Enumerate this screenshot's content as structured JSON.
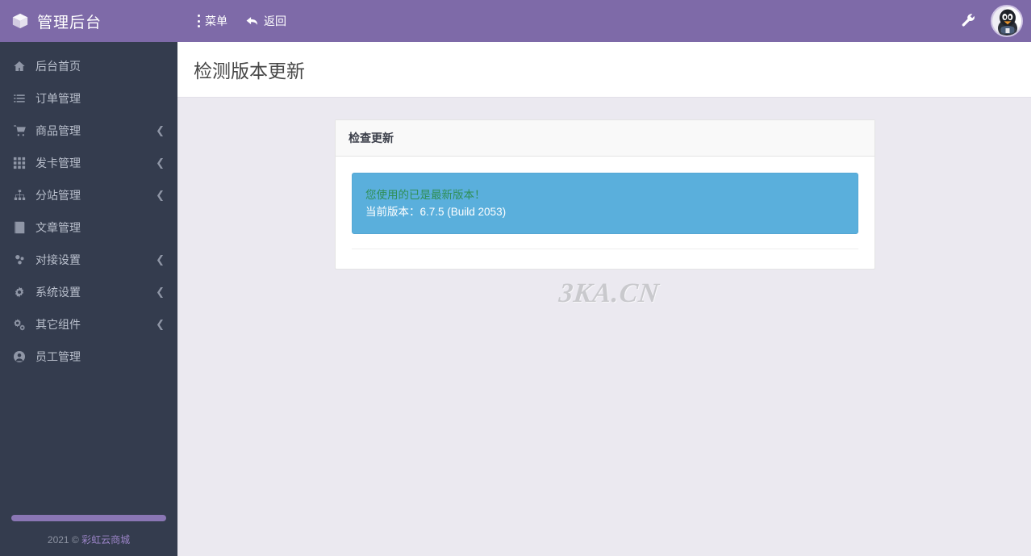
{
  "header": {
    "brand_title": "管理后台",
    "brand_icon": "cube-icon",
    "nav": [
      {
        "label": "菜单",
        "icon": "vertical-dots-icon"
      },
      {
        "label": "返回",
        "icon": "back-arrow-icon"
      }
    ],
    "tools_icon": "wrench-icon",
    "avatar_icon": "qq-penguin-avatar",
    "bar_color": "#7e6aa8"
  },
  "sidebar": {
    "background_color": "#343c4e",
    "items": [
      {
        "label": "后台首页",
        "icon": "home-icon",
        "has_submenu": false
      },
      {
        "label": "订单管理",
        "icon": "list-icon",
        "has_submenu": false
      },
      {
        "label": "商品管理",
        "icon": "cart-icon",
        "has_submenu": true
      },
      {
        "label": "发卡管理",
        "icon": "grid-icon",
        "has_submenu": true
      },
      {
        "label": "分站管理",
        "icon": "sitemap-icon",
        "has_submenu": true
      },
      {
        "label": "文章管理",
        "icon": "book-icon",
        "has_submenu": false
      },
      {
        "label": "对接设置",
        "icon": "cubes-icon",
        "has_submenu": true
      },
      {
        "label": "系统设置",
        "icon": "gear-icon",
        "has_submenu": true
      },
      {
        "label": "其它组件",
        "icon": "gears-icon",
        "has_submenu": true
      },
      {
        "label": "员工管理",
        "icon": "user-circle-icon",
        "has_submenu": false
      }
    ],
    "chevron_glyph": "❮",
    "scrollbar_color": "#8a76b4",
    "footer": {
      "year": "2021 ©",
      "brand": " 彩虹云商城",
      "brand_color": "#9b84c7"
    }
  },
  "main": {
    "page_title": "检测版本更新",
    "panel": {
      "heading": "检查更新",
      "alert": {
        "type": "info",
        "background_color": "#5aafdc",
        "line_1": "您使用的已是最新版本！",
        "line_1_color": "#2f8f56",
        "line_2": "当前版本：6.7.5 (Build 2053)",
        "line_2_color": "#ffffff"
      }
    },
    "watermark": "3KA.CN"
  }
}
